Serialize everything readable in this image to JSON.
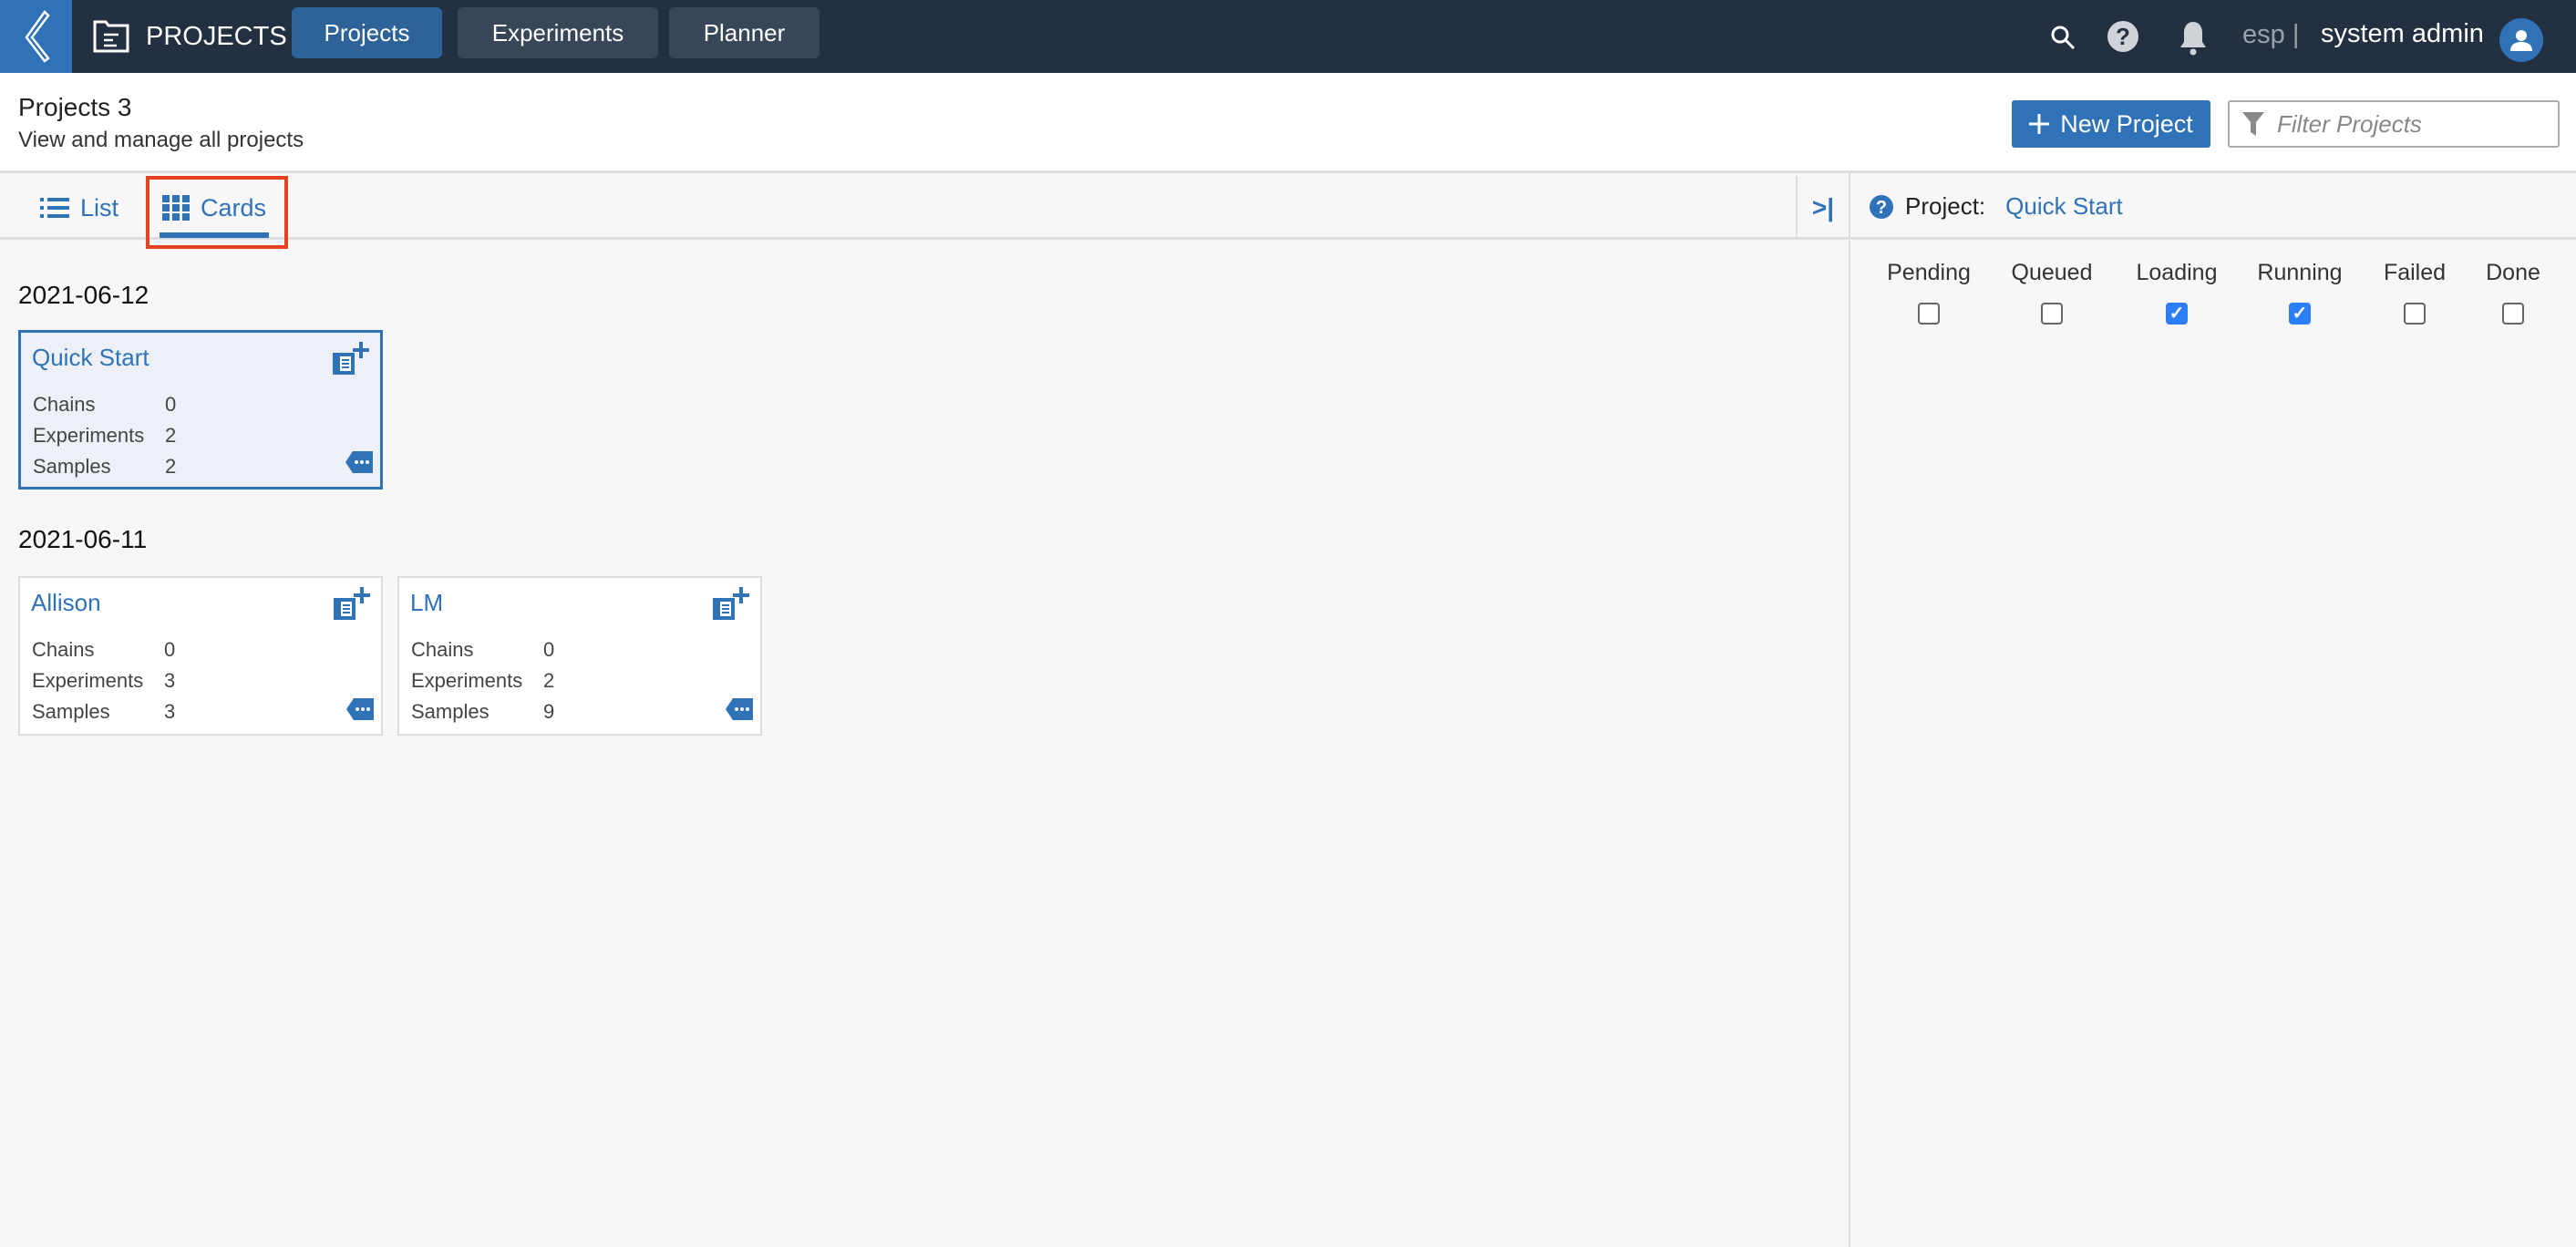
{
  "topbar": {
    "app_title": "PROJECTS",
    "tabs": [
      {
        "label": "Projects",
        "active": true
      },
      {
        "label": "Experiments",
        "active": false
      },
      {
        "label": "Planner",
        "active": false
      }
    ],
    "workspace": "esp",
    "separator": "|",
    "user": "system admin",
    "icons": [
      "search-icon",
      "help-icon",
      "bell-icon",
      "user-avatar-icon"
    ]
  },
  "header": {
    "title": "Projects 3",
    "subtitle": "View and manage all projects",
    "new_button": "New Project",
    "filter_placeholder": "Filter Projects"
  },
  "view_tabs": [
    {
      "label": "List",
      "icon": "list-icon",
      "active": false
    },
    {
      "label": "Cards",
      "icon": "grid-icon",
      "active": true
    }
  ],
  "collapse_label": ">|",
  "right_panel": {
    "label": "Project:",
    "project": "Quick Start",
    "statuses": [
      {
        "label": "Pending",
        "checked": false
      },
      {
        "label": "Queued",
        "checked": false
      },
      {
        "label": "Loading",
        "checked": true
      },
      {
        "label": "Running",
        "checked": true
      },
      {
        "label": "Failed",
        "checked": false
      },
      {
        "label": "Done",
        "checked": false
      }
    ]
  },
  "groups": [
    {
      "date": "2021-06-12",
      "cards": [
        {
          "title": "Quick Start",
          "selected": true,
          "rows": [
            [
              "Chains",
              "0"
            ],
            [
              "Experiments",
              "2"
            ],
            [
              "Samples",
              "2"
            ]
          ]
        }
      ]
    },
    {
      "date": "2021-06-11",
      "cards": [
        {
          "title": "Allison",
          "selected": false,
          "rows": [
            [
              "Chains",
              "0"
            ],
            [
              "Experiments",
              "3"
            ],
            [
              "Samples",
              "3"
            ]
          ]
        },
        {
          "title": "LM",
          "selected": false,
          "rows": [
            [
              "Chains",
              "0"
            ],
            [
              "Experiments",
              "2"
            ],
            [
              "Samples",
              "9"
            ]
          ]
        }
      ]
    }
  ],
  "colors": {
    "topbar": "#223041",
    "accent": "#2f72b8",
    "highlight": "#e5431f",
    "checkbox": "#2b7ef5"
  }
}
